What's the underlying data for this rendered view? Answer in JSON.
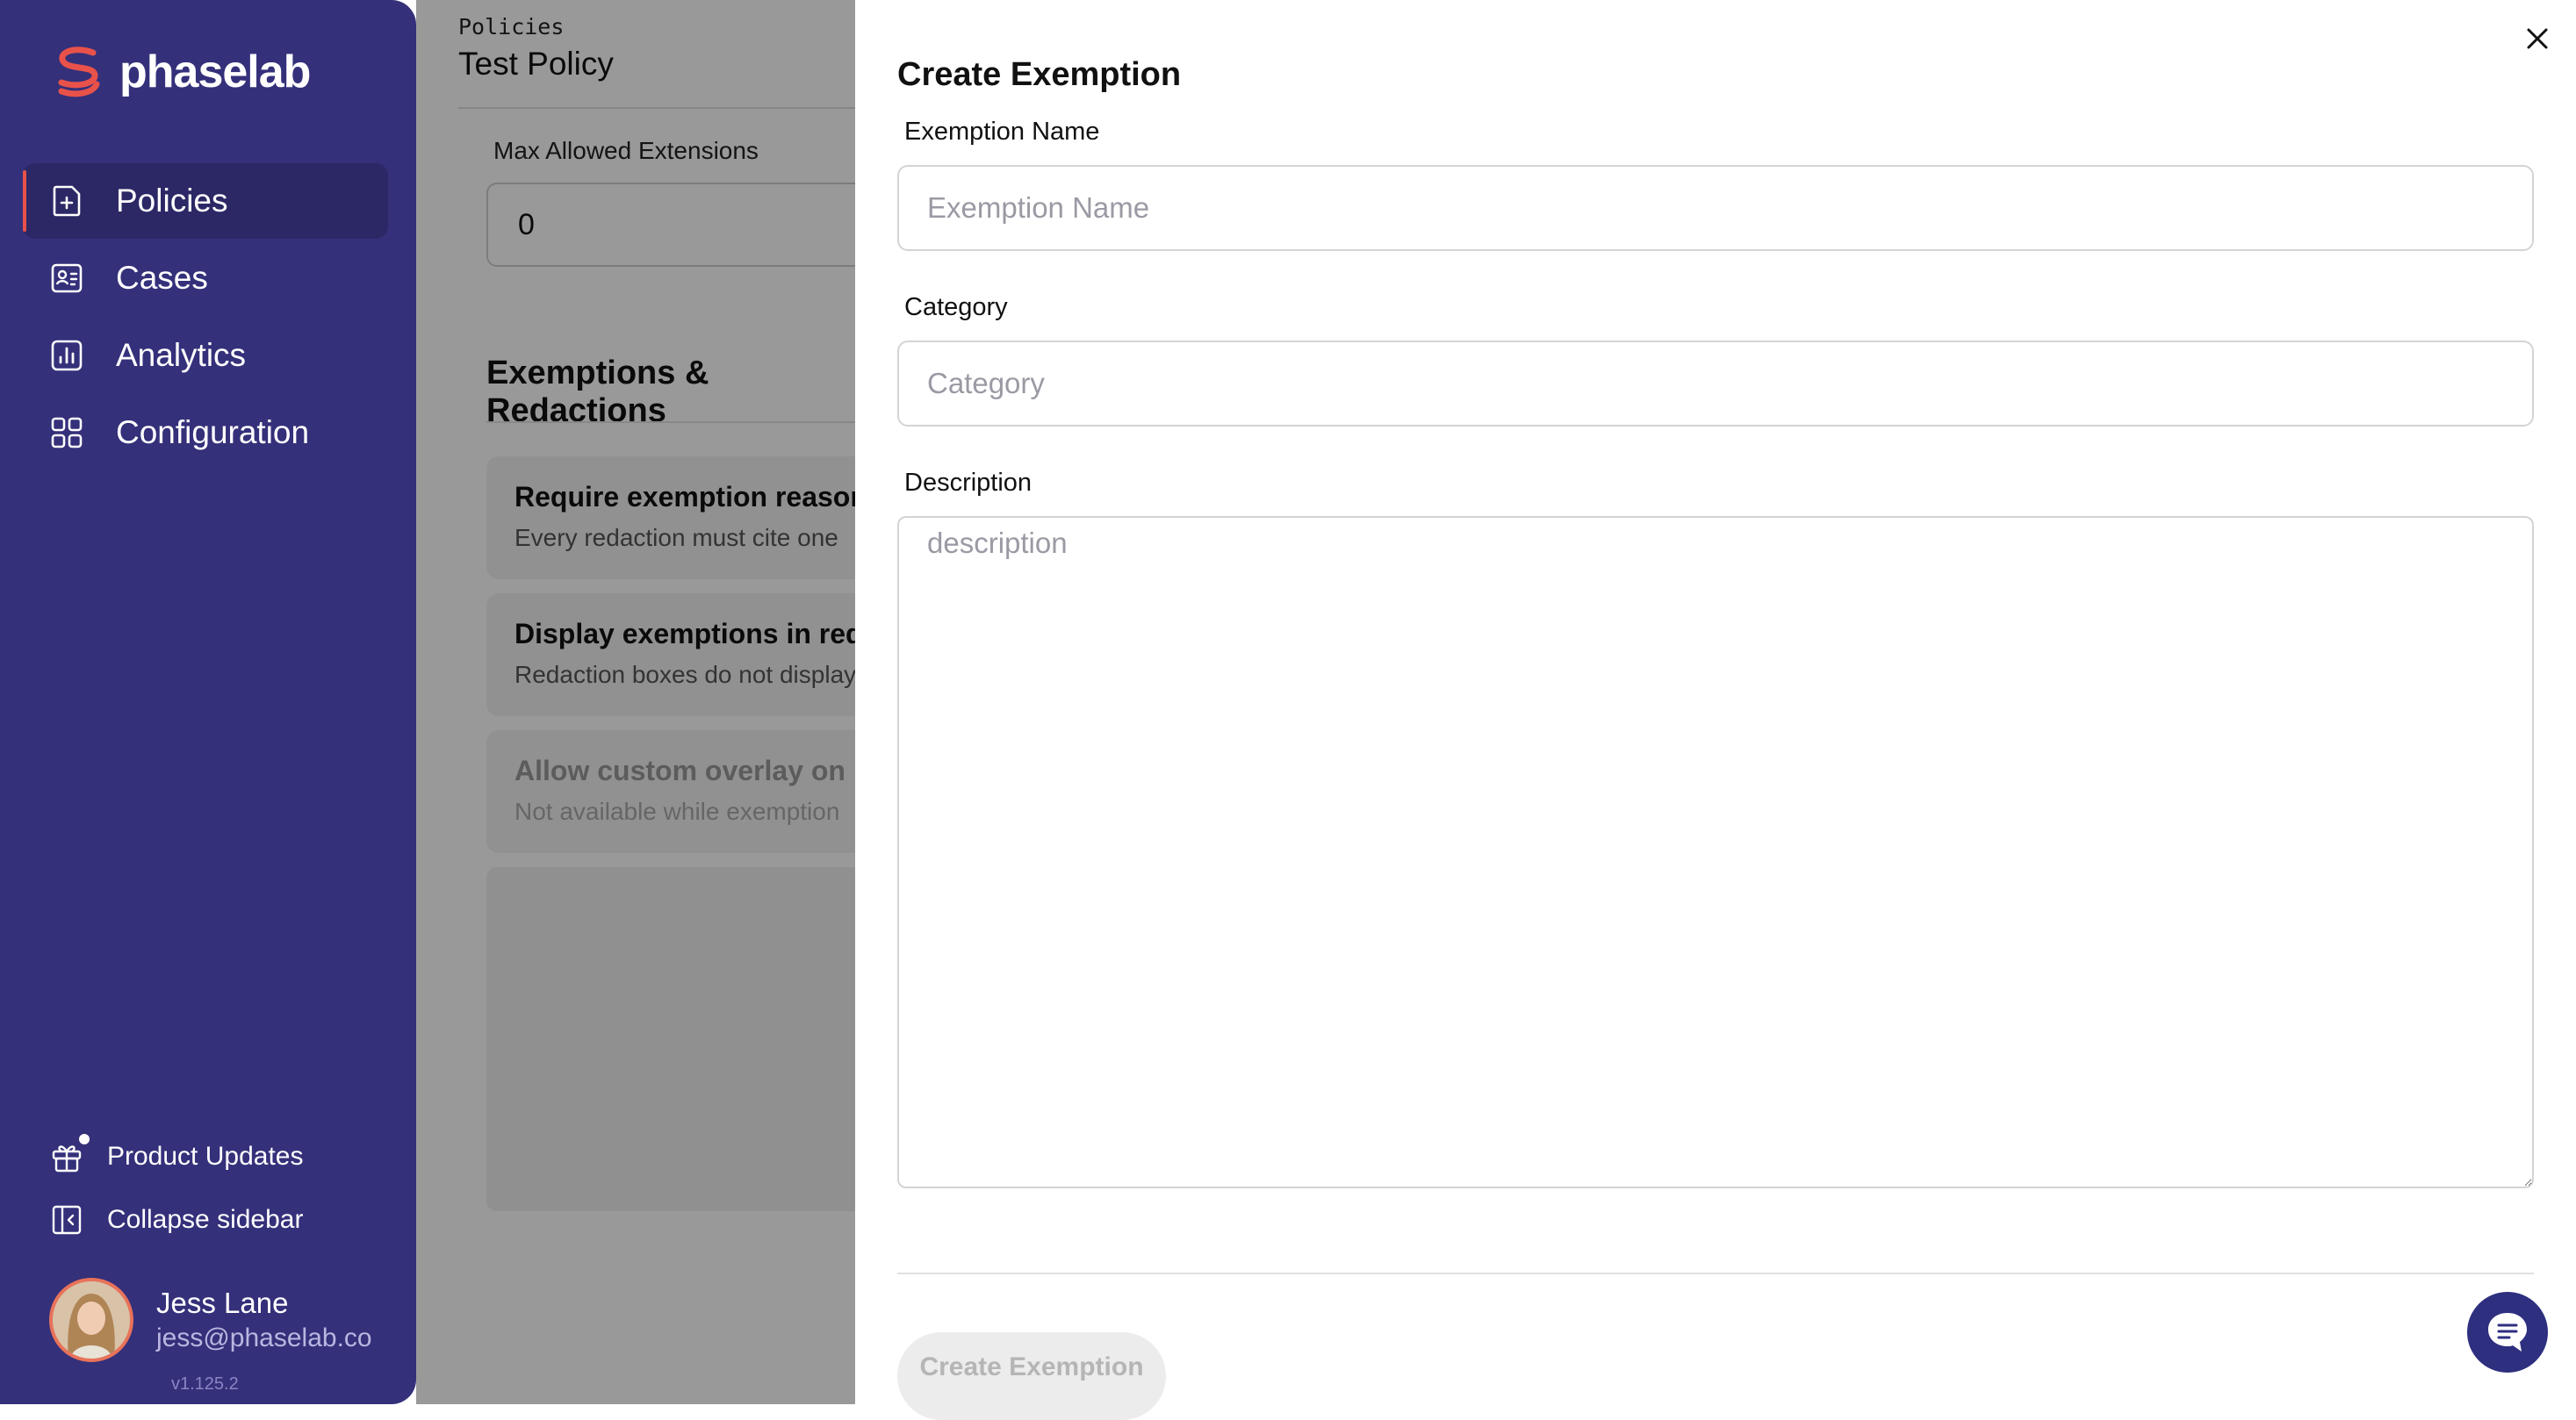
{
  "sidebar": {
    "logo_text": "phaselab",
    "nav_items": [
      {
        "label": "Policies",
        "icon": "policy-icon",
        "active": true
      },
      {
        "label": "Cases",
        "icon": "cases-icon",
        "active": false
      },
      {
        "label": "Analytics",
        "icon": "analytics-icon",
        "active": false
      },
      {
        "label": "Configuration",
        "icon": "grid-icon",
        "active": false
      }
    ],
    "product_updates_label": "Product Updates",
    "collapse_label": "Collapse sidebar",
    "user": {
      "name": "Jess Lane",
      "email": "jess@phaselab.co"
    },
    "version": "v1.125.2"
  },
  "main": {
    "breadcrumb": "Policies",
    "title": "Test Policy",
    "max_extensions_label": "Max Allowed Extensions",
    "max_extensions_value": "0",
    "section_title": "Exemptions & Redactions",
    "cards": [
      {
        "title": "Require exemption reasons",
        "subtitle": "Every redaction must cite one",
        "disabled": false
      },
      {
        "title": "Display exemptions in redactions",
        "subtitle": "Redaction boxes do not display",
        "disabled": false
      },
      {
        "title": "Allow custom overlay on redactions",
        "subtitle": "Not available while exemption",
        "disabled": true
      }
    ]
  },
  "drawer": {
    "title": "Create Exemption",
    "fields": {
      "name": {
        "label": "Exemption Name",
        "placeholder": "Exemption Name",
        "value": ""
      },
      "category": {
        "label": "Category",
        "placeholder": "Category",
        "value": ""
      },
      "description": {
        "label": "Description",
        "placeholder": "description",
        "value": ""
      }
    },
    "submit_label": "Create Exemption",
    "submit_disabled": true
  },
  "colors": {
    "sidebar_bg": "#34307a",
    "accent": "#e8524a",
    "chat_button": "#2e2f7f"
  }
}
